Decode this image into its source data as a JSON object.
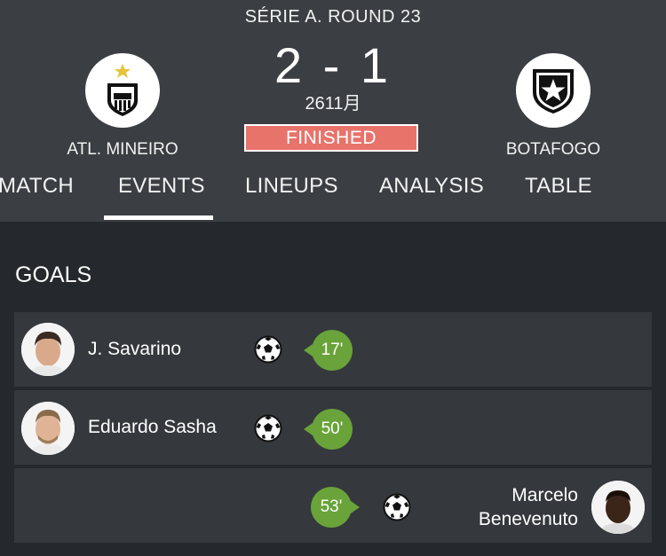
{
  "match": {
    "round": "SÉRIE A. ROUND 23",
    "score": "2 - 1",
    "date": "2611月",
    "status": "FINISHED",
    "home_team": "ATL. MINEIRO",
    "away_team": "BOTAFOGO",
    "home_crest_icon": "atletico-mineiro-crest-icon",
    "away_crest_icon": "botafogo-crest-icon"
  },
  "tabs": [
    {
      "label": "MATCH"
    },
    {
      "label": "EVENTS",
      "active": true
    },
    {
      "label": "LINEUPS"
    },
    {
      "label": "ANALYSIS"
    },
    {
      "label": "TABLE"
    }
  ],
  "goals": {
    "title": "GOALS",
    "events": [
      {
        "player": "J. Savarino",
        "minute": "17'",
        "side": "home",
        "icon": "soccer-ball-icon"
      },
      {
        "player": "Eduardo Sasha",
        "minute": "50'",
        "side": "home",
        "icon": "soccer-ball-icon"
      },
      {
        "player_line1": "Marcelo",
        "player_line2": "Benevenuto",
        "minute": "53'",
        "side": "away",
        "icon": "soccer-ball-icon"
      }
    ]
  },
  "colors": {
    "header_bg": "#3b3e42",
    "body_bg": "#25282c",
    "row_bg": "#35383c",
    "finished_badge": "#e8736b",
    "minute_badge": "#69a33a"
  }
}
